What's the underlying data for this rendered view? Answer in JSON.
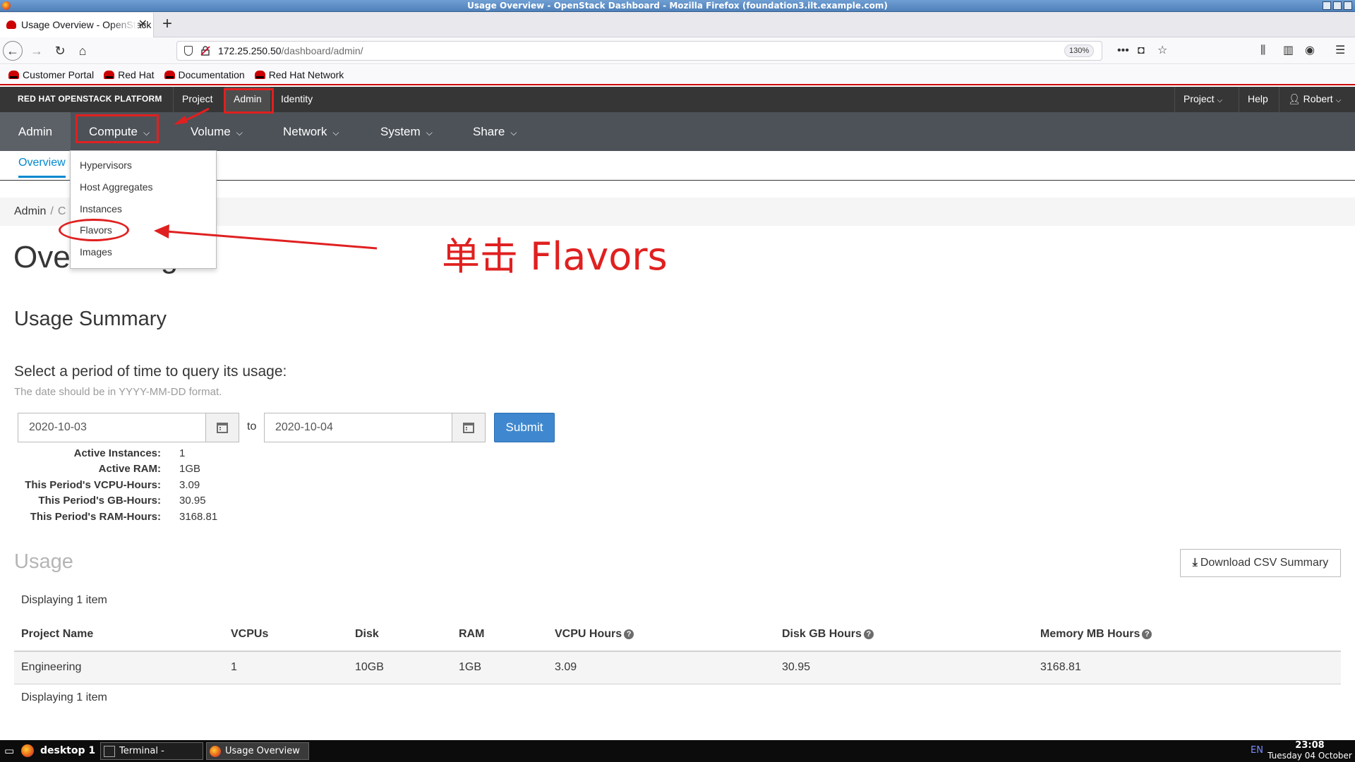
{
  "window": {
    "title": "Usage Overview - OpenStack Dashboard - Mozilla Firefox (foundation3.ilt.example.com)"
  },
  "browser": {
    "tab_title": "Usage Overview - OpenStack Dashboard",
    "url_host": "172.25.250.50",
    "url_path": "/dashboard/admin/",
    "zoom": "130%",
    "bookmarks": [
      "Customer Portal",
      "Red Hat",
      "Documentation",
      "Red Hat Network"
    ]
  },
  "masthead": {
    "brand": "RED HAT OPENSTACK PLATFORM",
    "nav": [
      "Project",
      "Admin",
      "Identity"
    ],
    "right": {
      "project": "Project",
      "help": "Help",
      "user": "Robert"
    }
  },
  "secondary_nav": {
    "admin": "Admin",
    "items": [
      "Compute",
      "Volume",
      "Network",
      "System",
      "Share"
    ]
  },
  "tertiary": {
    "overview": "Overview"
  },
  "compute_menu": [
    "Hypervisors",
    "Host Aggregates",
    "Instances",
    "Flavors",
    "Images"
  ],
  "breadcrumb": {
    "first": "Admin",
    "sep": "/",
    "current": "C"
  },
  "page": {
    "title": "Ove",
    "title_tail": "g",
    "usage_summary": "Usage Summary",
    "query_label": "Select a period of time to query its usage:",
    "query_help": "The date should be in YYYY-MM-DD format.",
    "date_from": "2020-10-03",
    "to": "to",
    "date_to": "2020-10-04",
    "submit": "Submit"
  },
  "stats": [
    {
      "label": "Active Instances:",
      "value": "1"
    },
    {
      "label": "Active RAM:",
      "value": "1GB"
    },
    {
      "label": "This Period's VCPU-Hours:",
      "value": "3.09"
    },
    {
      "label": "This Period's GB-Hours:",
      "value": "30.95"
    },
    {
      "label": "This Period's RAM-Hours:",
      "value": "3168.81"
    }
  ],
  "usage": {
    "heading": "Usage",
    "download": "Download CSV Summary",
    "displaying_top": "Displaying 1 item",
    "displaying_bottom": "Displaying 1 item",
    "columns": [
      "Project Name",
      "VCPUs",
      "Disk",
      "RAM",
      "VCPU Hours",
      "Disk GB Hours",
      "Memory MB Hours"
    ],
    "rows": [
      [
        "Engineering",
        "1",
        "10GB",
        "1GB",
        "3.09",
        "30.95",
        "3168.81"
      ]
    ]
  },
  "annotation": {
    "text": "单击 Flavors",
    "color": "#e02020"
  },
  "taskbar": {
    "desktop": "desktop 1",
    "tasks": [
      "Terminal - kiosk@...",
      "Usage Overview -..."
    ],
    "lang": "EN",
    "time": "23:08",
    "date": "Tuesday 04 October"
  },
  "colors": {
    "accent": "#0088ce",
    "masthead": "#363636",
    "secnav": "#4d5258",
    "submit": "#3f88cf"
  }
}
